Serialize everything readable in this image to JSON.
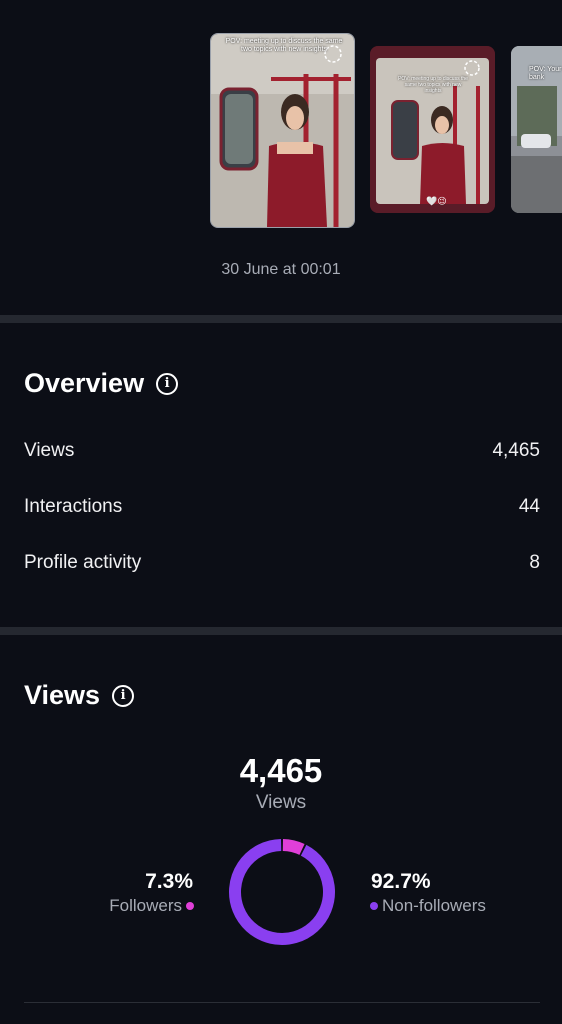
{
  "stories": {
    "items": [
      {
        "caption": "POV: meeting up to discuss the same two topics with new insights"
      },
      {
        "caption": "POV: meeting up to discuss the same two topics with new insights"
      },
      {
        "caption": "POV: Your bank"
      }
    ],
    "date": "30 June at 00:01"
  },
  "overview": {
    "title": "Overview",
    "rows": [
      {
        "label": "Views",
        "value": "4,465"
      },
      {
        "label": "Interactions",
        "value": "44"
      },
      {
        "label": "Profile activity",
        "value": "8"
      }
    ]
  },
  "views": {
    "title": "Views",
    "total": "4,465",
    "total_label": "Views",
    "followers": {
      "percent": "7.3%",
      "label": "Followers",
      "color": "#e03fd8"
    },
    "non_followers": {
      "percent": "92.7%",
      "label": "Non-followers",
      "color": "#8a3ff0"
    }
  },
  "chart_data": {
    "type": "pie",
    "categories": [
      "Followers",
      "Non-followers"
    ],
    "values": [
      7.3,
      92.7
    ],
    "title": "",
    "colors": [
      "#e03fd8",
      "#8a3ff0"
    ]
  }
}
